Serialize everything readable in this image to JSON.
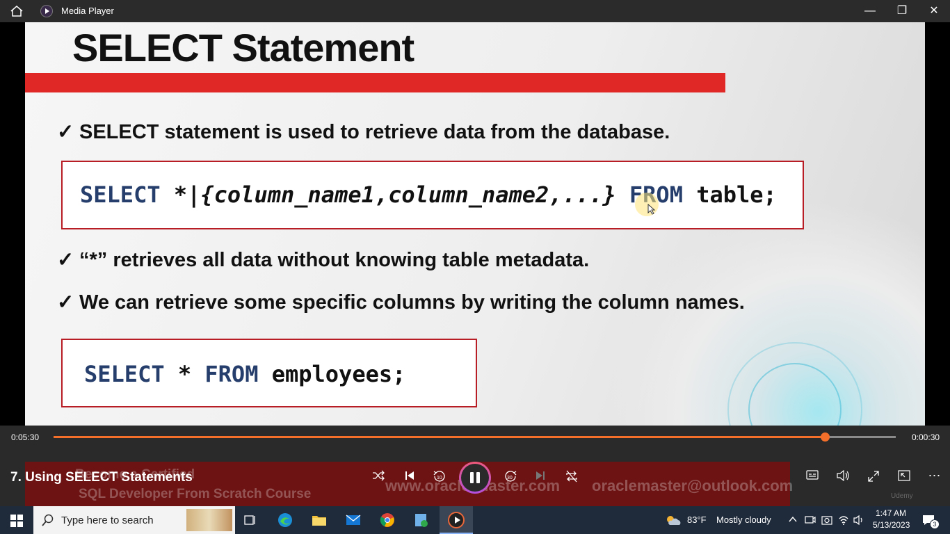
{
  "window": {
    "title": "Media Player",
    "minimize": "—",
    "restore": "❐",
    "close": "✕"
  },
  "slide": {
    "title": "SELECT Statement",
    "bullet1": "SELECT statement is used to retrieve data from the database.",
    "syntax": {
      "select": "SELECT",
      "star": "*|",
      "columns": "{column_name1,column_name2,...}",
      "from": "FROM",
      "table": "table;"
    },
    "bullet2": "“*” retrieves all data without knowing table metadata.",
    "bullet3": "We can retrieve some specific columns by writing the column names.",
    "example": {
      "select": "SELECT",
      "star": "*",
      "from": "FROM",
      "table": "employees;"
    },
    "check": "✓"
  },
  "player": {
    "elapsed": "0:05:30",
    "remaining": "0:00:30",
    "progress_fraction": 0.916,
    "video_title": "7. Using SELECT Statements",
    "overlay_line1": "Become a Certified",
    "overlay_line2": "SQL  Developer  From Scratch Course",
    "overlay_web": "www.oracle-master.com",
    "overlay_email": "oraclemaster@outlook.com",
    "watermark": "Udemy"
  },
  "taskbar": {
    "search_placeholder": "Type here to search",
    "weather_temp": "83°F",
    "weather_text": "Mostly cloudy",
    "time": "1:47 AM",
    "date": "5/13/2023",
    "notification_count": "3"
  }
}
